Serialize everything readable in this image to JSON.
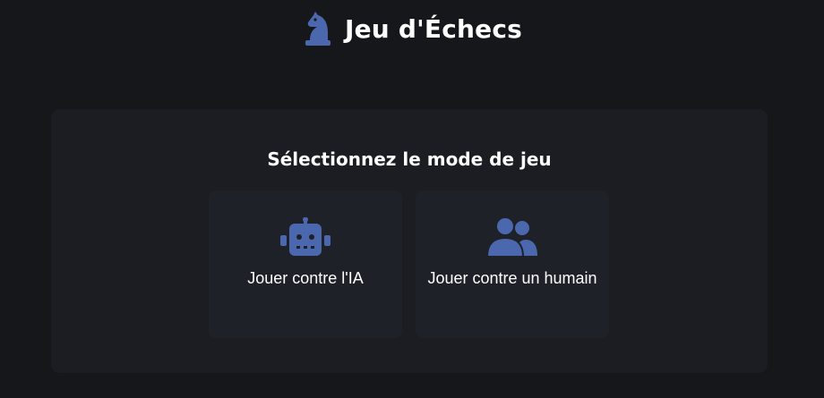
{
  "header": {
    "title": "Jeu d'Échecs",
    "logo_icon": "chess-knight-icon"
  },
  "mode_selection": {
    "heading": "Sélectionnez le mode de jeu",
    "options": [
      {
        "label": "Jouer contre l'IA",
        "icon": "robot-icon"
      },
      {
        "label": "Jouer contre un humain",
        "icon": "users-icon"
      }
    ]
  },
  "colors": {
    "background": "#16171b",
    "panel": "#1b1d23",
    "card": "#1f2129",
    "accent": "#4b67ad",
    "text": "#ffffff"
  }
}
